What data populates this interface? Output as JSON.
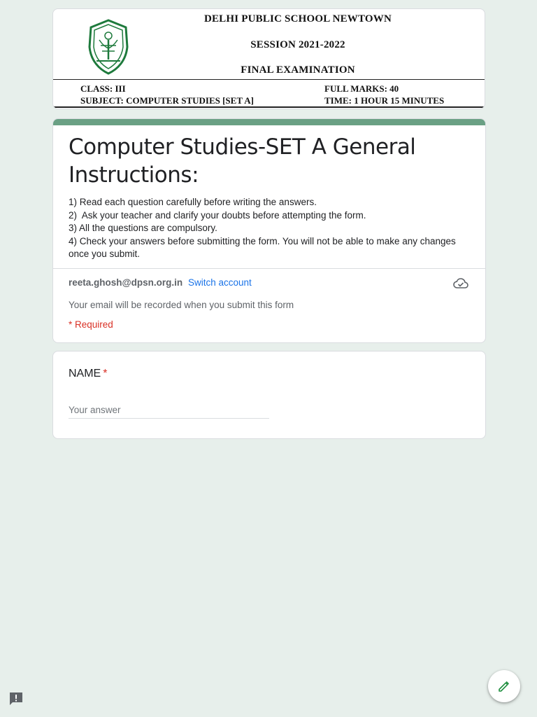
{
  "banner": {
    "school": "DELHI PUBLIC SCHOOL NEWTOWN",
    "session": "SESSION 2021-2022",
    "exam": "FINAL EXAMINATION",
    "class_label": "CLASS: III",
    "subject_label": "SUBJECT: COMPUTER STUDIES [SET A]",
    "full_marks": "FULL MARKS: 40",
    "time": "TIME: 1 HOUR 15 MINUTES",
    "logo_icon": "school-crest-logo"
  },
  "form": {
    "title": "Computer Studies-SET A General Instructions:",
    "instructions": [
      "1) Read each question carefully before writing the answers.",
      "2)  Ask your teacher and clarify your doubts before attempting the form.",
      "3) All the questions are compulsory.",
      "4) Check your answers before submitting the form. You will not be able to make any changes once you submit."
    ],
    "account_email": "reeta.ghosh@dpsn.org.in",
    "switch_account": "Switch account",
    "email_note": "Your email will be recorded when you submit this form",
    "required_note": "* Required",
    "accent_color": "#6aa084"
  },
  "question": {
    "label": "NAME",
    "required_mark": "*",
    "placeholder": "Your answer",
    "value": ""
  },
  "icons": {
    "cloud": "cloud-check-icon",
    "feedback": "report-feedback-icon",
    "edit": "pencil-edit-icon"
  }
}
